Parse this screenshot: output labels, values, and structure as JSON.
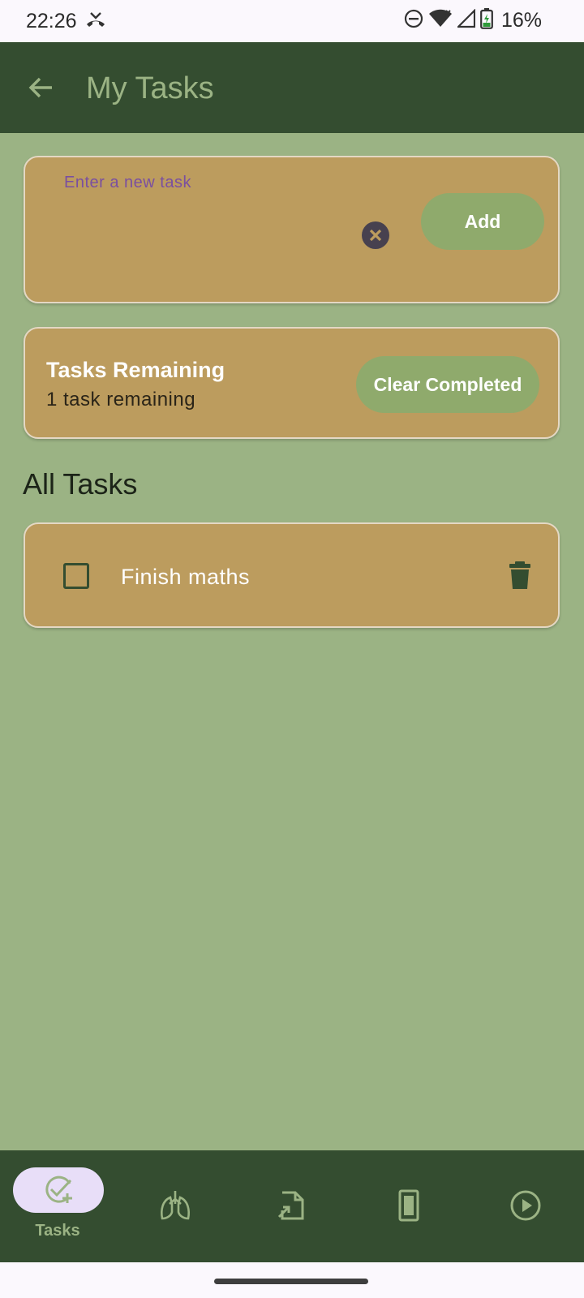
{
  "status_bar": {
    "time": "22:26",
    "battery_percent": "16%",
    "icons": [
      "missed-call-icon",
      "do-not-disturb-icon",
      "wifi-icon",
      "signal-icon",
      "battery-icon"
    ]
  },
  "app_bar": {
    "title": "My Tasks",
    "back_icon": "arrow-back-icon"
  },
  "new_task": {
    "placeholder": "Enter a new task",
    "value": "",
    "clear_icon": "cancel-icon",
    "add_label": "Add"
  },
  "summary": {
    "title": "Tasks Remaining",
    "subtitle": "1 task remaining",
    "clear_label": "Clear Completed"
  },
  "section": {
    "heading": "All Tasks"
  },
  "tasks": [
    {
      "label": "Finish maths",
      "checked": false,
      "delete_icon": "trash-icon"
    }
  ],
  "bottom_nav": {
    "items": [
      {
        "label": "Tasks",
        "icon": "task-add-icon",
        "selected": true
      },
      {
        "label": "",
        "icon": "lungs-icon",
        "selected": false
      },
      {
        "label": "",
        "icon": "file-import-icon",
        "selected": false
      },
      {
        "label": "",
        "icon": "tablet-icon",
        "selected": false
      },
      {
        "label": "",
        "icon": "play-circle-icon",
        "selected": false
      }
    ]
  },
  "colors": {
    "background": "#9bb384",
    "app_bar": "#344d30",
    "card": "#bc9c5e",
    "button": "#8faa6c",
    "nav_selected_pill": "#e8def8",
    "placeholder": "#7a4fa0"
  }
}
